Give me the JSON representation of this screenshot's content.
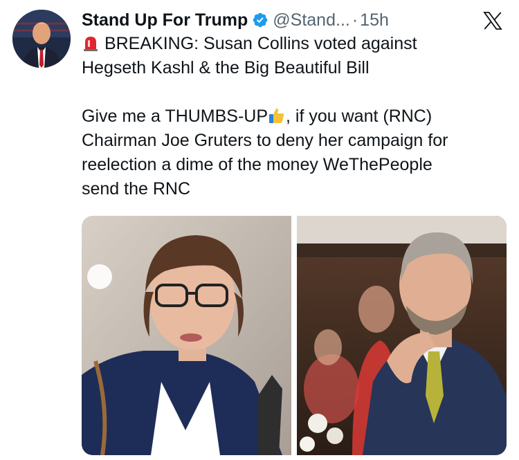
{
  "tweet": {
    "display_name": "Stand Up For Trump",
    "handle": "@Stand...",
    "separator": "·",
    "time": "15h",
    "line1": "BREAKING: Susan Collins voted against",
    "line2": "Hegseth Kashl & the Big Beautiful Bill",
    "line3a": "Give me a THUMBS-UP",
    "line3b": ", if you want (RNC)",
    "line4": "Chairman Joe Gruters to deny her campaign for",
    "line5": "reelection a dime of the money WeThePeople",
    "line6": "send the RNC"
  },
  "icons": {
    "verified": "verified-badge-icon",
    "brand": "x-logo-icon",
    "siren": "siren-emoji-icon",
    "thumbs_up": "thumbs-up-emoji-icon"
  },
  "colors": {
    "verified_blue": "#1d9bf0",
    "muted_text": "#536471"
  }
}
